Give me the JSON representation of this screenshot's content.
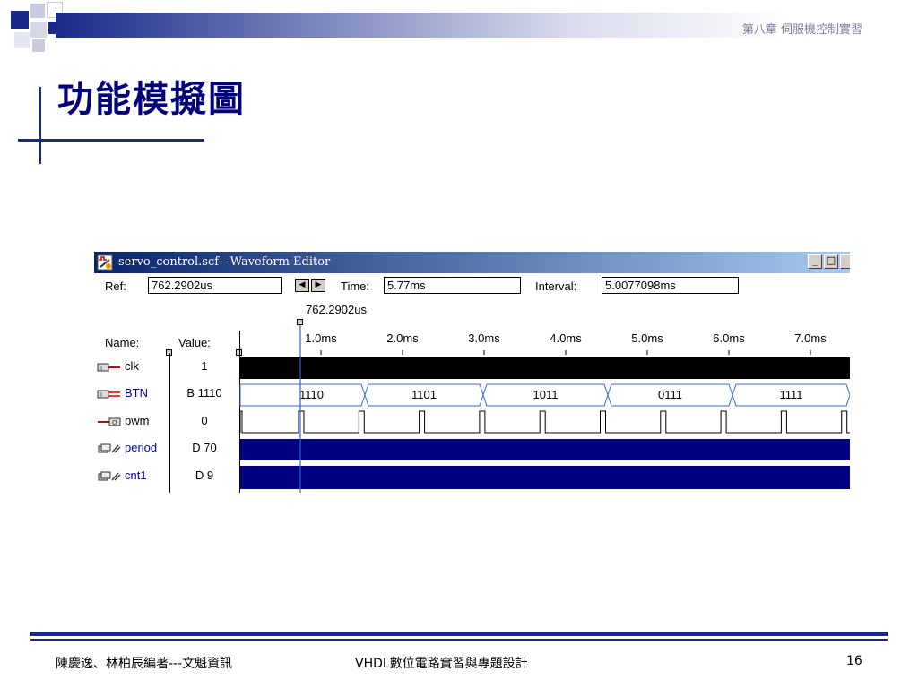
{
  "slide": {
    "chapter": "第八章  伺服機控制實習",
    "title": "功能模擬圖"
  },
  "window": {
    "title": "servo_control.scf - Waveform Editor",
    "ref_label": "Ref:",
    "ref_value": "762.2902us",
    "time_label": "Time:",
    "time_value": "5.77ms",
    "interval_label": "Interval:",
    "interval_value": "5.0077098ms",
    "cursor_label": "762.2902us",
    "name_header": "Name:",
    "value_header": "Value:",
    "minimize_glyph": "_",
    "maximize_glyph": "□",
    "time_ticks": [
      "1.0ms",
      "2.0ms",
      "3.0ms",
      "4.0ms",
      "5.0ms",
      "6.0ms",
      "7.0ms"
    ]
  },
  "signals": [
    {
      "name": "clk",
      "value": "1",
      "color": "#000000"
    },
    {
      "name": "BTN",
      "value": "B 1110",
      "color": "#00009c"
    },
    {
      "name": "pwm",
      "value": "0",
      "color": "#000000"
    },
    {
      "name": "period",
      "value": "D 70",
      "color": "#00009c"
    },
    {
      "name": "cnt1",
      "value": "D 9",
      "color": "#00009c"
    }
  ],
  "btn_segments": [
    "1110",
    "1101",
    "1011",
    "0111",
    "1111"
  ],
  "footer": {
    "authors": "陳慶逸、林柏辰編著---文魁資訊",
    "book": "VHDL數位電路實習與專題設計",
    "page": "16"
  },
  "colors": {
    "accent": "#1a2a8a",
    "title": "#00007a",
    "bus_fill": "#000080"
  }
}
